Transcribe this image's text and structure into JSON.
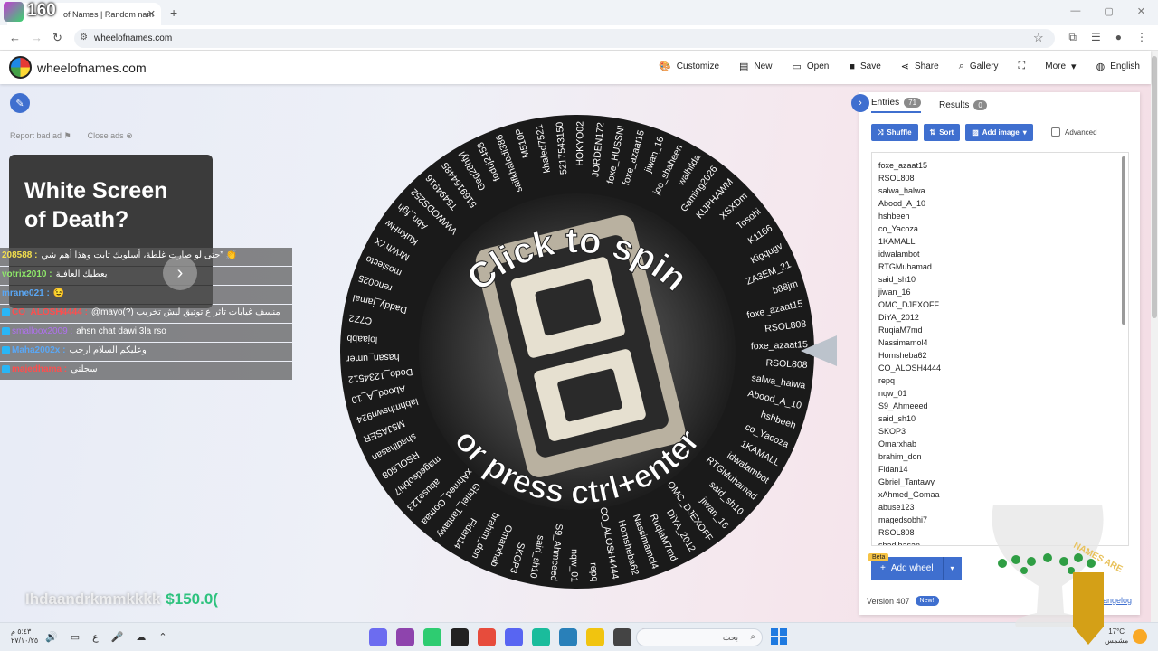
{
  "browser": {
    "tab_title": "of Names | Random nam",
    "url": "wheelofnames.com",
    "overlay_number": "160"
  },
  "header": {
    "site_name": "wheelofnames.com",
    "menu": [
      {
        "label": "Customize",
        "icon": "palette-icon"
      },
      {
        "label": "New",
        "icon": "new-file-icon"
      },
      {
        "label": "Open",
        "icon": "folder-icon"
      },
      {
        "label": "Save",
        "icon": "save-icon"
      },
      {
        "label": "Share",
        "icon": "share-icon"
      },
      {
        "label": "Gallery",
        "icon": "search-icon"
      },
      {
        "label": "",
        "icon": "fullscreen-icon"
      },
      {
        "label": "More",
        "icon": "chevron-down-icon"
      },
      {
        "label": "English",
        "icon": "globe-icon"
      }
    ]
  },
  "ad": {
    "report": "Report bad ad",
    "close": "Close ads",
    "title_line1": "White Screen",
    "title_line2": "of Death?"
  },
  "chat": [
    {
      "user": "208588 :",
      "message": "حتى لو صارت غلطة، أسلوبك ثابت وهذا أهم شي” 👏",
      "color": "u1"
    },
    {
      "user": "votrix2010 :",
      "message": "يعطيك العافية",
      "color": "u2"
    },
    {
      "user": "mrane021 :",
      "message": "😉",
      "color": "u3"
    },
    {
      "user": "CO_ALOSH4444 :",
      "message": "@mayo(?) منسف غيابات تاثر ع توتيق ليش تخريب",
      "color": "u4"
    },
    {
      "user": "smalloox2009 :",
      "message": "ahsn chat dawi 3la rso",
      "color": "u5"
    },
    {
      "user": "Maha2002x :",
      "message": "وعليكم السلام ارحب",
      "color": "u3"
    },
    {
      "user": "majedhama :",
      "message": "سجلني",
      "color": "u4"
    }
  ],
  "donation": {
    "blurred_name": "Ihdaandrkmmkkkk",
    "amount": "$150.0("
  },
  "wheel": {
    "center_text_top": "Click to spin",
    "center_text_bottom": "or press ctrl+enter",
    "slice_labels": [
      "foxe_azaat15",
      "RSOL808",
      "salwa_halwa",
      "Abood_A_10",
      "hshbeeh",
      "co_Yacoza",
      "1KAMALL",
      "idwalambot",
      "RTGMuhamad",
      "said_sh10",
      "jiwan_16",
      "OMC_DJEXOFF",
      "DiYA_2012",
      "RuqiaM7md",
      "Nassimamol4",
      "Homsheba62",
      "CO_ALOSH4444",
      "repq",
      "nqw_01",
      "S9_Ahmeeed",
      "said_sh10",
      "SKOP3",
      "Omarxhab",
      "brahim_don",
      "Fidan14",
      "Gbriel_Tantawy",
      "xAhmed_Gomaa",
      "abuse123",
      "magedsobhi7",
      "RSOL808",
      "shadihasan",
      "M5JASER",
      "labhmhswn924",
      "Abood_A_10",
      "Dodo_1234512",
      "hasan_umer",
      "lojaabb",
      "C7Z2",
      "Daddy_jamal",
      "reno025",
      "mosiecto",
      "MrWhYX",
      "KuKnHw",
      "Abn_fgh",
      "VWWODS252",
      "T5494916",
      "5169164485",
      "Geg28hfyl",
      "foduj2458",
      "saifkhaledi386",
      "M510P",
      "khaled7521",
      "5217543150",
      "HOKYO02",
      "JORDEN172",
      "foxe_HUSSNI",
      "foxe_azaat15",
      "jiwan_16",
      "joo_shaheen",
      "walhilda",
      "Gaming2026",
      "KIJPHAWM",
      "XSXDm",
      "Tosohi",
      "K1166",
      "Kigqugv",
      "ZA3EM_21",
      "b88jm",
      "foxe_azaat15",
      "RSOL808"
    ]
  },
  "panel": {
    "tab_entries": "Entries",
    "entries_count": "71",
    "tab_results": "Results",
    "results_count": "0",
    "shuffle": "Shuffle",
    "sort": "Sort",
    "add_image": "Add image",
    "advanced": "Advanced",
    "entries": [
      "foxe_azaat15",
      "RSOL808",
      "salwa_halwa",
      "Abood_A_10",
      "hshbeeh",
      "co_Yacoza",
      "1KAMALL",
      "idwalambot",
      "RTGMuhamad",
      "said_sh10",
      "jiwan_16",
      "OMC_DJEXOFF",
      "DiYA_2012",
      "RuqiaM7md",
      "Nassimamol4",
      "Homsheba62",
      "CO_ALOSH4444",
      "repq",
      "nqw_01",
      "S9_Ahmeeed",
      "said_sh10",
      "SKOP3",
      "Omarxhab",
      "brahim_don",
      "Fidan14",
      "Gbriel_Tantawy",
      "xAhmed_Gomaa",
      "abuse123",
      "magedsobhi7",
      "RSOL808",
      "shadihasan"
    ],
    "beta": "Beta",
    "add_wheel": "Add wheel",
    "version": "Version 407",
    "new_badge": "New!",
    "changelog": "angelog"
  },
  "overlay_glass_text": "NAMES ARE",
  "taskbar": {
    "time": "٥:٤٣ م",
    "date": "٢٧/١٠/٢٥",
    "search_placeholder": "بحث",
    "temp": "17°C",
    "weather": "مشمس",
    "ime": "ع"
  },
  "colors": {
    "accent": "#3f6fcf",
    "donation_green": "#2ec27e"
  }
}
